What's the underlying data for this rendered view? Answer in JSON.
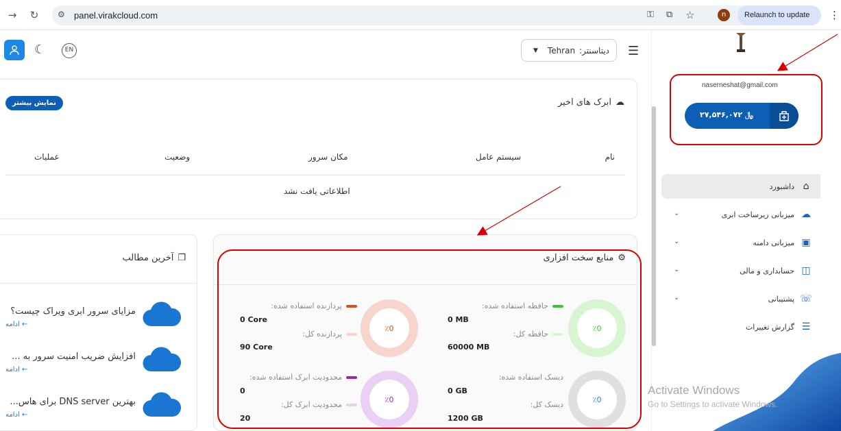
{
  "browser": {
    "url": "panel.virakcloud.com",
    "relaunch_label": "Relaunch to update",
    "profile_initial": "n"
  },
  "topbar": {
    "lang_label": "EN",
    "datacenter_label": "دیتاسنتر:",
    "datacenter_value": "Tehran"
  },
  "recent_clouds": {
    "title": "ابرک های اخیر",
    "show_more": "نمایش بیشتر",
    "columns": [
      "نام",
      "سیستم عامل",
      "مکان سرور",
      "وضعیت",
      "عملیات"
    ],
    "empty_text": "اطلاعاتی یافت نشد"
  },
  "hardware": {
    "title": "منابع سخت افزاری",
    "cards": [
      {
        "used_label": "حافظه استفاده شده:",
        "used_value": "0 MB",
        "total_label": "حافظه کل:",
        "total_value": "60000 MB",
        "percent": "٪0",
        "color": "#37c837",
        "light": "#d8f5d2"
      },
      {
        "used_label": "پردازنده استفاده شده:",
        "used_value": "0 Core",
        "total_label": "پردازنده کل:",
        "total_value": "90 Core",
        "percent": "٪0",
        "color": "#e64a19",
        "light": "#f7d5cc"
      },
      {
        "used_label": "دیسک استفاده شده:",
        "used_value": "0 GB",
        "total_label": "دیسک کل:",
        "total_value": "1200 GB",
        "percent": "٪0",
        "color": "#1e88e5",
        "light": "#e0e0e0"
      },
      {
        "used_label": "محدودیت ابرک استفاده شده:",
        "used_value": "0",
        "total_label": "محدودیت ابرک کل:",
        "total_value": "20",
        "percent": "٪0",
        "color": "#9c27b0",
        "light": "#ead0f3"
      }
    ]
  },
  "articles": {
    "title": "آخرین مطالب",
    "items": [
      {
        "title": "مزایای سرور ابری ویراک چیست؟",
        "more": "ادامه ←"
      },
      {
        "title": "افزایش ضریب امنیت سرور به ...",
        "more": "ادامه ←"
      },
      {
        "title": "بهترین DNS server برای هاس...",
        "more": "ادامه ←"
      }
    ]
  },
  "sidebar": {
    "email": "naserneshat@gmail.com",
    "balance": "۲۷,۵۴۶,۰۷۲",
    "currency": "﷼",
    "items": [
      {
        "label": "داشبورد",
        "icon": "home-icon"
      },
      {
        "label": "میزبانی زیرساخت ابری",
        "icon": "cloud-icon"
      },
      {
        "label": "میزبانی دامنه",
        "icon": "domain-icon"
      },
      {
        "label": "حسابداری و مالی",
        "icon": "wallet-icon"
      },
      {
        "label": "پشتیبانی",
        "icon": "support-icon"
      },
      {
        "label": "گزارش تغییرات",
        "icon": "changelog-icon"
      }
    ]
  },
  "watermark": {
    "line1": "Activate Windows",
    "line2": "Go to Settings to activate Windows."
  },
  "colors": {
    "primary": "#0d5fb6",
    "annotation": "#d90000"
  }
}
